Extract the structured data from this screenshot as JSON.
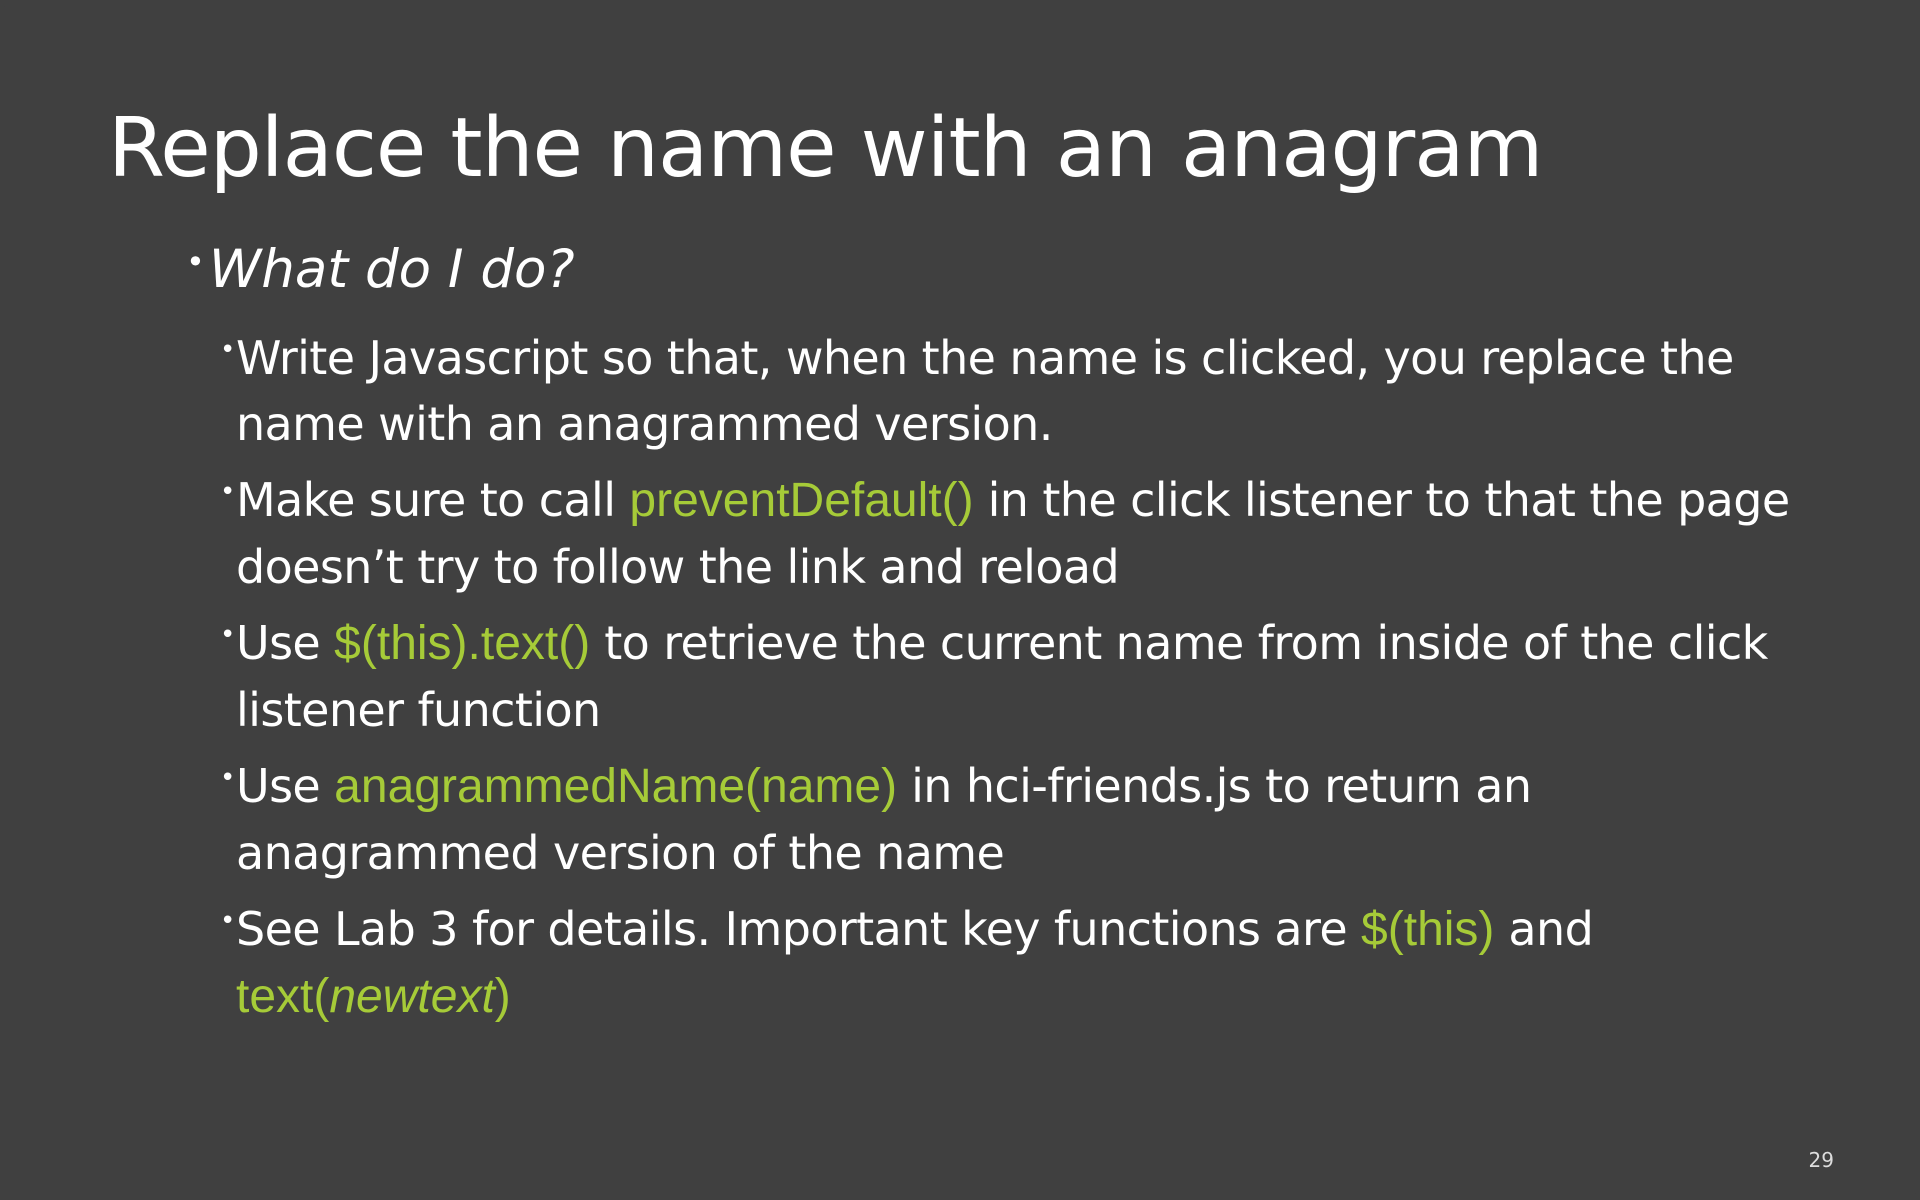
{
  "slide": {
    "title": "Replace the name with an anagram",
    "subtitle": "What do I do?",
    "bullet_glyph": "•",
    "page_number": "29",
    "code_color": "#a6cb38",
    "bullets": [
      {
        "text1": "Write Javascript so that, when the name is clicked, you replace the name with an anagrammed version."
      },
      {
        "text1": "Make sure to call ",
        "code1": "preventDefault()",
        "text2": " in the click listener to that the page doesn’t try to follow the link and reload"
      },
      {
        "text1": "Use ",
        "code1": "$(this).text()",
        "text2": " to retrieve the current name from inside of the click listener function"
      },
      {
        "text1": "Use ",
        "code1": "anagrammedName(name)",
        "text2": " in hci-friends.js to return an anagrammed version of the name"
      },
      {
        "text1": "See Lab 3 for details. Important key functions are ",
        "code1": "$(this)",
        "text2": " and ",
        "code2a": "text(",
        "code2b": "newtext",
        "code2c": ")"
      }
    ]
  }
}
